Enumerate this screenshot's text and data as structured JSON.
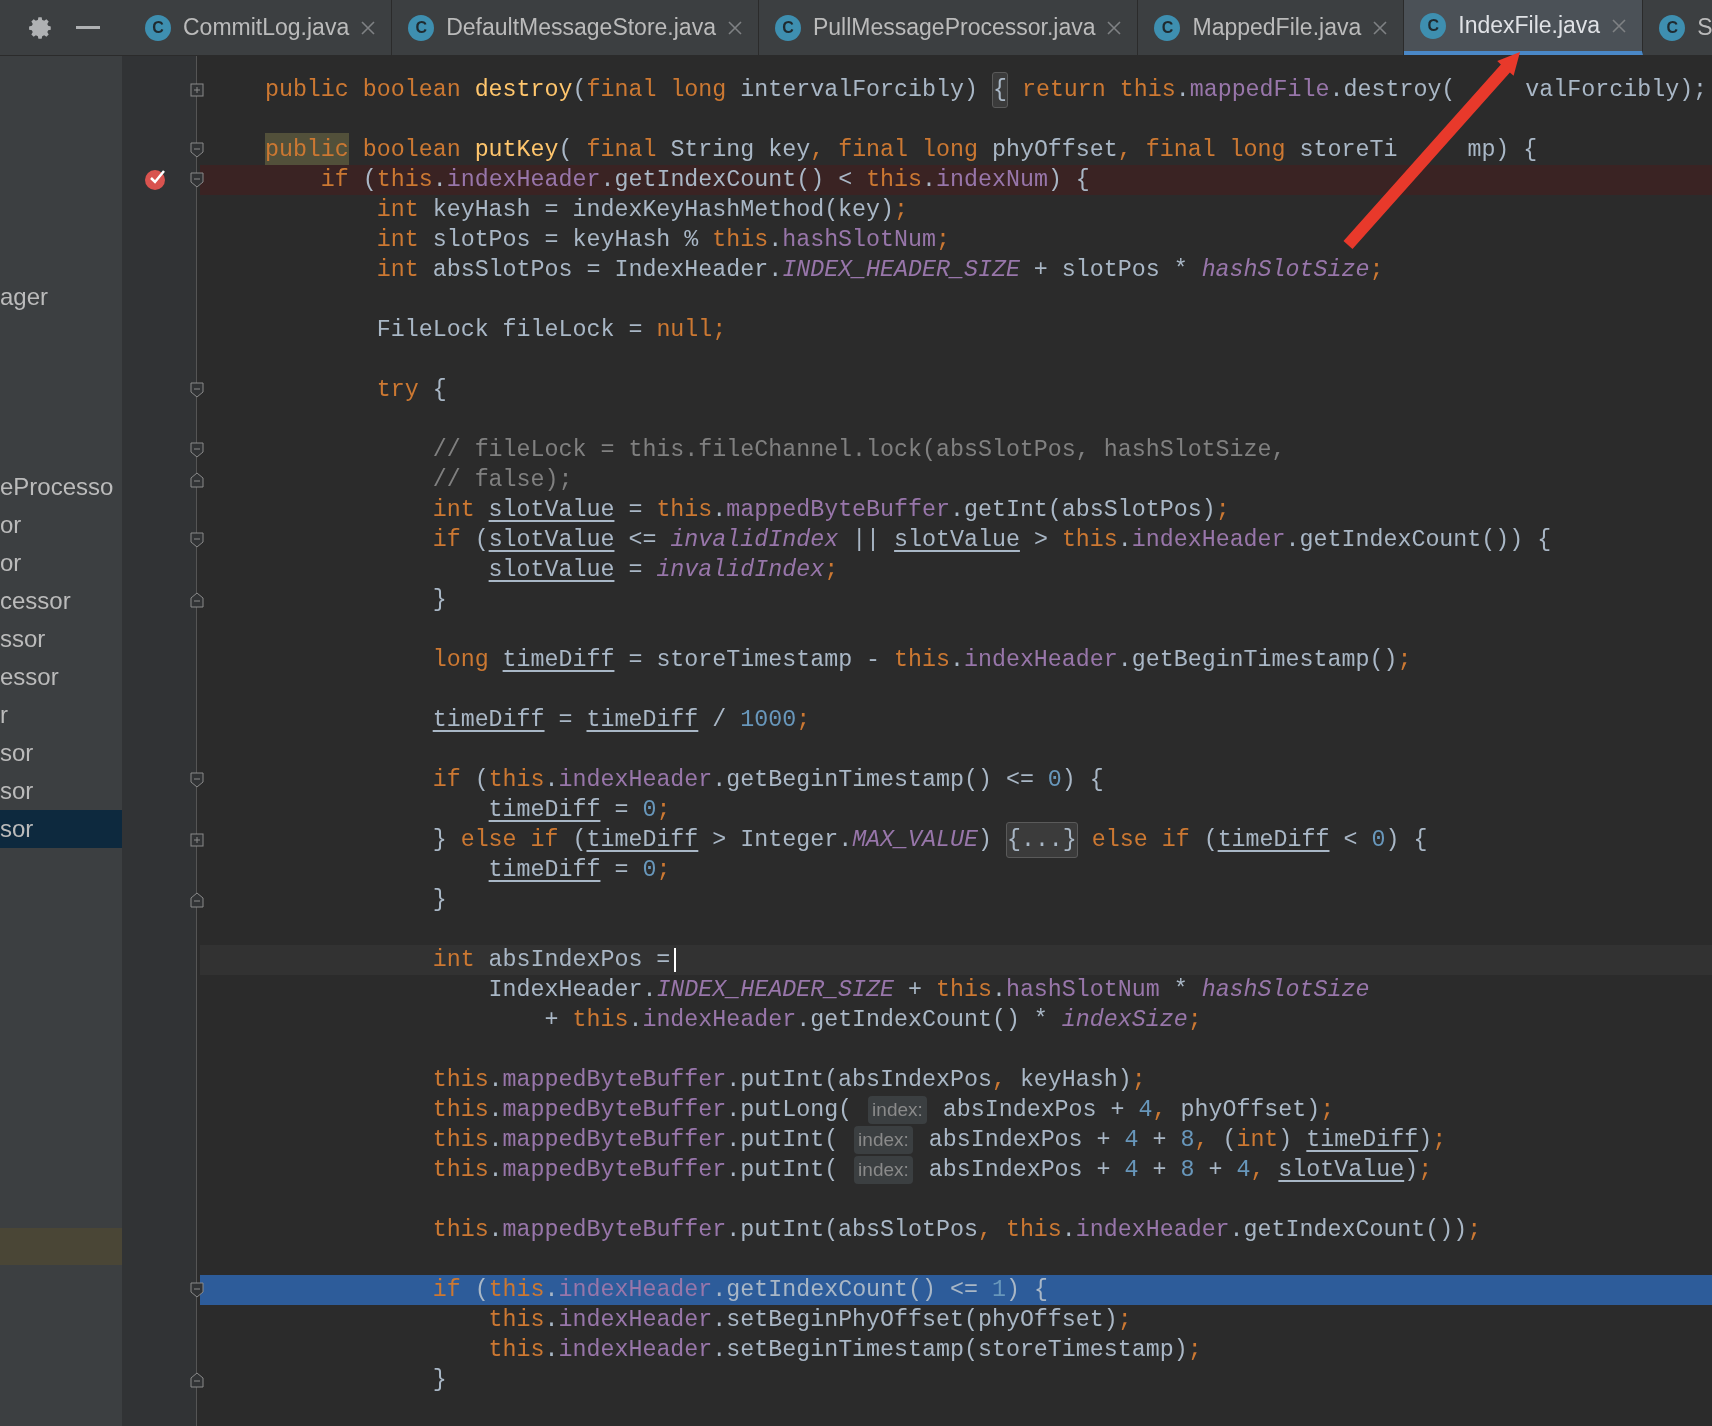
{
  "tabs": [
    {
      "icon_letter": "C",
      "label": "CommitLog.java",
      "selected": false
    },
    {
      "icon_letter": "C",
      "label": "DefaultMessageStore.java",
      "selected": false
    },
    {
      "icon_letter": "C",
      "label": "PullMessageProcessor.java",
      "selected": false
    },
    {
      "icon_letter": "C",
      "label": "MappedFile.java",
      "selected": false
    },
    {
      "icon_letter": "C",
      "label": "IndexFile.java",
      "selected": true
    },
    {
      "icon_letter": "C",
      "label": "S",
      "selected": false
    }
  ],
  "sidebar": {
    "items": [
      {
        "label": "ager",
        "selected": false
      },
      {
        "label": "eProcesso",
        "selected": false
      },
      {
        "label": "or",
        "selected": false
      },
      {
        "label": "or",
        "selected": false
      },
      {
        "label": "cessor",
        "selected": false
      },
      {
        "label": "ssor",
        "selected": false
      },
      {
        "label": "essor",
        "selected": false
      },
      {
        "label": "r",
        "selected": false
      },
      {
        "label": "sor",
        "selected": false
      },
      {
        "label": "sor",
        "selected": false
      },
      {
        "label": "sor",
        "selected": true
      }
    ]
  },
  "editor": {
    "lines": [
      {
        "kind": "code",
        "collapsed": true,
        "tokens": [
          {
            "kind": "k",
            "text": "    public boolean "
          },
          {
            "kind": "m",
            "text": "destroy"
          },
          {
            "kind": "p",
            "text": "("
          },
          {
            "kind": "k",
            "text": "final long "
          },
          {
            "kind": "p",
            "text": "intervalForcibly) "
          },
          {
            "kind": "fold",
            "text": "{"
          },
          {
            "kind": "k",
            "text": " return this"
          },
          {
            "kind": "p",
            "text": "."
          },
          {
            "kind": "f",
            "text": "mappedFile"
          },
          {
            "kind": "p",
            "text": ".destroy("
          },
          {
            "kind": "gap"
          },
          {
            "kind": "p",
            "text": "valForcibly);"
          }
        ]
      },
      {
        "kind": "blank"
      },
      {
        "kind": "code",
        "fold_start": true,
        "tokens": [
          {
            "kind": "hl",
            "text": "    public"
          },
          {
            "kind": "k",
            "text": " boolean "
          },
          {
            "kind": "m",
            "text": "putKey"
          },
          {
            "kind": "p",
            "text": "( "
          },
          {
            "kind": "k",
            "text": "final "
          },
          {
            "kind": "p",
            "text": "String key"
          },
          {
            "kind": "k",
            "text": ", final long "
          },
          {
            "kind": "p",
            "text": "phyOffset"
          },
          {
            "kind": "k",
            "text": ", final long "
          },
          {
            "kind": "p",
            "text": "storeTi"
          },
          {
            "kind": "gap"
          },
          {
            "kind": "p",
            "text": "mp) {"
          }
        ]
      },
      {
        "kind": "code",
        "fold_start": true,
        "breakpoint": true,
        "tokens": [
          {
            "kind": "k",
            "text": "        if "
          },
          {
            "kind": "p",
            "text": "("
          },
          {
            "kind": "k",
            "text": "this"
          },
          {
            "kind": "p",
            "text": "."
          },
          {
            "kind": "f",
            "text": "indexHeader"
          },
          {
            "kind": "p",
            "text": ".getIndexCount() < "
          },
          {
            "kind": "k",
            "text": "this"
          },
          {
            "kind": "p",
            "text": "."
          },
          {
            "kind": "f",
            "text": "indexNum"
          },
          {
            "kind": "p",
            "text": ") {"
          }
        ]
      },
      {
        "kind": "code",
        "tokens": [
          {
            "kind": "k",
            "text": "            int "
          },
          {
            "kind": "p",
            "text": "keyHash = indexKeyHashMethod(key)"
          },
          {
            "kind": "k",
            "text": ";"
          }
        ]
      },
      {
        "kind": "code",
        "tokens": [
          {
            "kind": "k",
            "text": "            int "
          },
          {
            "kind": "p",
            "text": "slotPos = keyHash % "
          },
          {
            "kind": "k",
            "text": "this"
          },
          {
            "kind": "p",
            "text": "."
          },
          {
            "kind": "f",
            "text": "hashSlotNum"
          },
          {
            "kind": "k",
            "text": ";"
          }
        ]
      },
      {
        "kind": "code",
        "tokens": [
          {
            "kind": "k",
            "text": "            int "
          },
          {
            "kind": "p",
            "text": "absSlotPos = IndexHeader."
          },
          {
            "kind": "s",
            "text": "INDEX_HEADER_SIZE"
          },
          {
            "kind": "p",
            "text": " + slotPos * "
          },
          {
            "kind": "s",
            "text": "hashSlotSize"
          },
          {
            "kind": "k",
            "text": ";"
          }
        ]
      },
      {
        "kind": "blank"
      },
      {
        "kind": "code",
        "tokens": [
          {
            "kind": "p",
            "text": "            FileLock fileLock = "
          },
          {
            "kind": "k",
            "text": "null;"
          }
        ]
      },
      {
        "kind": "blank"
      },
      {
        "kind": "code",
        "fold_start": true,
        "tokens": [
          {
            "kind": "k",
            "text": "            try "
          },
          {
            "kind": "p",
            "text": "{"
          }
        ]
      },
      {
        "kind": "blank"
      },
      {
        "kind": "code",
        "fold_start": true,
        "tokens": [
          {
            "kind": "c",
            "text": "                // fileLock = this.fileChannel.lock(absSlotPos, hashSlotSize,"
          }
        ]
      },
      {
        "kind": "code",
        "fold_end": true,
        "tokens": [
          {
            "kind": "c",
            "text": "                // false);"
          }
        ]
      },
      {
        "kind": "code",
        "tokens": [
          {
            "kind": "k",
            "text": "                int "
          },
          {
            "kind": "u",
            "text": "slotValue"
          },
          {
            "kind": "p",
            "text": " = "
          },
          {
            "kind": "k",
            "text": "this"
          },
          {
            "kind": "p",
            "text": "."
          },
          {
            "kind": "f",
            "text": "mappedByteBuffer"
          },
          {
            "kind": "p",
            "text": ".getInt(absSlotPos)"
          },
          {
            "kind": "k",
            "text": ";"
          }
        ]
      },
      {
        "kind": "code",
        "fold_start": true,
        "tokens": [
          {
            "kind": "k",
            "text": "                if "
          },
          {
            "kind": "p",
            "text": "("
          },
          {
            "kind": "u",
            "text": "slotValue"
          },
          {
            "kind": "p",
            "text": " <= "
          },
          {
            "kind": "s",
            "text": "invalidIndex"
          },
          {
            "kind": "p",
            "text": " || "
          },
          {
            "kind": "u",
            "text": "slotValue"
          },
          {
            "kind": "p",
            "text": " > "
          },
          {
            "kind": "k",
            "text": "this"
          },
          {
            "kind": "p",
            "text": "."
          },
          {
            "kind": "f",
            "text": "indexHeader"
          },
          {
            "kind": "p",
            "text": ".getIndexCount()) {"
          }
        ]
      },
      {
        "kind": "code",
        "tokens": [
          {
            "kind": "u",
            "text": "                    slotValue"
          },
          {
            "kind": "p",
            "text": " = "
          },
          {
            "kind": "s",
            "text": "invalidIndex"
          },
          {
            "kind": "k",
            "text": ";"
          }
        ]
      },
      {
        "kind": "code",
        "fold_end": true,
        "tokens": [
          {
            "kind": "p",
            "text": "                }"
          }
        ]
      },
      {
        "kind": "blank"
      },
      {
        "kind": "code",
        "tokens": [
          {
            "kind": "k",
            "text": "                long "
          },
          {
            "kind": "u",
            "text": "timeDiff"
          },
          {
            "kind": "p",
            "text": " = storeTimestamp - "
          },
          {
            "kind": "k",
            "text": "this"
          },
          {
            "kind": "p",
            "text": "."
          },
          {
            "kind": "f",
            "text": "indexHeader"
          },
          {
            "kind": "p",
            "text": ".getBeginTimestamp()"
          },
          {
            "kind": "k",
            "text": ";"
          }
        ]
      },
      {
        "kind": "blank"
      },
      {
        "kind": "code",
        "tokens": [
          {
            "kind": "u",
            "text": "                timeDiff"
          },
          {
            "kind": "p",
            "text": " = "
          },
          {
            "kind": "u",
            "text": "timeDiff"
          },
          {
            "kind": "p",
            "text": " / "
          },
          {
            "kind": "n",
            "text": "1000"
          },
          {
            "kind": "k",
            "text": ";"
          }
        ]
      },
      {
        "kind": "blank"
      },
      {
        "kind": "code",
        "fold_start": true,
        "tokens": [
          {
            "kind": "k",
            "text": "                if "
          },
          {
            "kind": "p",
            "text": "("
          },
          {
            "kind": "k",
            "text": "this"
          },
          {
            "kind": "p",
            "text": "."
          },
          {
            "kind": "f",
            "text": "indexHeader"
          },
          {
            "kind": "p",
            "text": ".getBeginTimestamp() <= "
          },
          {
            "kind": "n",
            "text": "0"
          },
          {
            "kind": "p",
            "text": ") {"
          }
        ]
      },
      {
        "kind": "code",
        "tokens": [
          {
            "kind": "u",
            "text": "                    timeDiff"
          },
          {
            "kind": "p",
            "text": " = "
          },
          {
            "kind": "n",
            "text": "0"
          },
          {
            "kind": "k",
            "text": ";"
          }
        ]
      },
      {
        "kind": "code",
        "collapsed": true,
        "tokens": [
          {
            "kind": "p",
            "text": "                } "
          },
          {
            "kind": "k",
            "text": "else if "
          },
          {
            "kind": "p",
            "text": "("
          },
          {
            "kind": "u",
            "text": "timeDiff"
          },
          {
            "kind": "p",
            "text": " > Integer."
          },
          {
            "kind": "s",
            "text": "MAX_VALUE"
          },
          {
            "kind": "p",
            "text": ") "
          },
          {
            "kind": "fold",
            "text": "{...}"
          },
          {
            "kind": "k",
            "text": " else if "
          },
          {
            "kind": "p",
            "text": "("
          },
          {
            "kind": "u",
            "text": "timeDiff"
          },
          {
            "kind": "p",
            "text": " < "
          },
          {
            "kind": "n",
            "text": "0"
          },
          {
            "kind": "p",
            "text": ") {"
          }
        ]
      },
      {
        "kind": "code",
        "tokens": [
          {
            "kind": "u",
            "text": "                    timeDiff"
          },
          {
            "kind": "p",
            "text": " = "
          },
          {
            "kind": "n",
            "text": "0"
          },
          {
            "kind": "k",
            "text": ";"
          }
        ]
      },
      {
        "kind": "code",
        "fold_end": true,
        "tokens": [
          {
            "kind": "p",
            "text": "                }"
          }
        ]
      },
      {
        "kind": "blank"
      },
      {
        "kind": "code",
        "caret": true,
        "tokens": [
          {
            "kind": "k",
            "text": "                int "
          },
          {
            "kind": "p",
            "text": "absIndexPos ="
          }
        ]
      },
      {
        "kind": "code",
        "tokens": [
          {
            "kind": "p",
            "text": "                    IndexHeader."
          },
          {
            "kind": "s",
            "text": "INDEX_HEADER_SIZE"
          },
          {
            "kind": "p",
            "text": " + "
          },
          {
            "kind": "k",
            "text": "this"
          },
          {
            "kind": "p",
            "text": "."
          },
          {
            "kind": "f",
            "text": "hashSlotNum"
          },
          {
            "kind": "p",
            "text": " * "
          },
          {
            "kind": "s",
            "text": "hashSlotSize"
          }
        ]
      },
      {
        "kind": "code",
        "tokens": [
          {
            "kind": "p",
            "text": "                        + "
          },
          {
            "kind": "k",
            "text": "this"
          },
          {
            "kind": "p",
            "text": "."
          },
          {
            "kind": "f",
            "text": "indexHeader"
          },
          {
            "kind": "p",
            "text": ".getIndexCount() * "
          },
          {
            "kind": "s",
            "text": "indexSize"
          },
          {
            "kind": "k",
            "text": ";"
          }
        ]
      },
      {
        "kind": "blank"
      },
      {
        "kind": "code",
        "tokens": [
          {
            "kind": "k",
            "text": "                this"
          },
          {
            "kind": "p",
            "text": "."
          },
          {
            "kind": "f",
            "text": "mappedByteBuffer"
          },
          {
            "kind": "p",
            "text": ".putInt(absIndexPos"
          },
          {
            "kind": "k",
            "text": ", "
          },
          {
            "kind": "p",
            "text": "keyHash)"
          },
          {
            "kind": "k",
            "text": ";"
          }
        ]
      },
      {
        "kind": "code",
        "tokens": [
          {
            "kind": "k",
            "text": "                this"
          },
          {
            "kind": "p",
            "text": "."
          },
          {
            "kind": "f",
            "text": "mappedByteBuffer"
          },
          {
            "kind": "p",
            "text": ".putLong( "
          },
          {
            "kind": "h",
            "text": "index:"
          },
          {
            "kind": "p",
            "text": " absIndexPos + "
          },
          {
            "kind": "n",
            "text": "4"
          },
          {
            "kind": "k",
            "text": ", "
          },
          {
            "kind": "p",
            "text": "phyOffset)"
          },
          {
            "kind": "k",
            "text": ";"
          }
        ]
      },
      {
        "kind": "code",
        "tokens": [
          {
            "kind": "k",
            "text": "                this"
          },
          {
            "kind": "p",
            "text": "."
          },
          {
            "kind": "f",
            "text": "mappedByteBuffer"
          },
          {
            "kind": "p",
            "text": ".putInt( "
          },
          {
            "kind": "h",
            "text": "index:"
          },
          {
            "kind": "p",
            "text": " absIndexPos + "
          },
          {
            "kind": "n",
            "text": "4"
          },
          {
            "kind": "p",
            "text": " + "
          },
          {
            "kind": "n",
            "text": "8"
          },
          {
            "kind": "k",
            "text": ", "
          },
          {
            "kind": "p",
            "text": "("
          },
          {
            "kind": "k",
            "text": "int"
          },
          {
            "kind": "p",
            "text": ") "
          },
          {
            "kind": "u",
            "text": "timeDiff"
          },
          {
            "kind": "p",
            "text": ")"
          },
          {
            "kind": "k",
            "text": ";"
          }
        ]
      },
      {
        "kind": "code",
        "tokens": [
          {
            "kind": "k",
            "text": "                this"
          },
          {
            "kind": "p",
            "text": "."
          },
          {
            "kind": "f",
            "text": "mappedByteBuffer"
          },
          {
            "kind": "p",
            "text": ".putInt( "
          },
          {
            "kind": "h",
            "text": "index:"
          },
          {
            "kind": "p",
            "text": " absIndexPos + "
          },
          {
            "kind": "n",
            "text": "4"
          },
          {
            "kind": "p",
            "text": " + "
          },
          {
            "kind": "n",
            "text": "8"
          },
          {
            "kind": "p",
            "text": " + "
          },
          {
            "kind": "n",
            "text": "4"
          },
          {
            "kind": "k",
            "text": ", "
          },
          {
            "kind": "u",
            "text": "slotValue"
          },
          {
            "kind": "p",
            "text": ")"
          },
          {
            "kind": "k",
            "text": ";"
          }
        ]
      },
      {
        "kind": "blank"
      },
      {
        "kind": "code",
        "tokens": [
          {
            "kind": "k",
            "text": "                this"
          },
          {
            "kind": "p",
            "text": "."
          },
          {
            "kind": "f",
            "text": "mappedByteBuffer"
          },
          {
            "kind": "p",
            "text": ".putInt(absSlotPos"
          },
          {
            "kind": "k",
            "text": ", this"
          },
          {
            "kind": "p",
            "text": "."
          },
          {
            "kind": "f",
            "text": "indexHeader"
          },
          {
            "kind": "p",
            "text": ".getIndexCount())"
          },
          {
            "kind": "k",
            "text": ";"
          }
        ]
      },
      {
        "kind": "blank"
      },
      {
        "kind": "code",
        "fold_start": true,
        "selected": true,
        "tokens": [
          {
            "kind": "k",
            "text": "                if "
          },
          {
            "kind": "p",
            "text": "("
          },
          {
            "kind": "k",
            "text": "this"
          },
          {
            "kind": "p",
            "text": "."
          },
          {
            "kind": "f",
            "text": "indexHeader"
          },
          {
            "kind": "p",
            "text": ".getIndexCount() <= "
          },
          {
            "kind": "n",
            "text": "1"
          },
          {
            "kind": "p",
            "text": ") {"
          }
        ]
      },
      {
        "kind": "code",
        "tokens": [
          {
            "kind": "k",
            "text": "                    this"
          },
          {
            "kind": "p",
            "text": "."
          },
          {
            "kind": "f",
            "text": "indexHeader"
          },
          {
            "kind": "p",
            "text": ".setBeginPhyOffset(phyOffset)"
          },
          {
            "kind": "k",
            "text": ";"
          }
        ]
      },
      {
        "kind": "code",
        "tokens": [
          {
            "kind": "k",
            "text": "                    this"
          },
          {
            "kind": "p",
            "text": "."
          },
          {
            "kind": "f",
            "text": "indexHeader"
          },
          {
            "kind": "p",
            "text": ".setBeginTimestamp(storeTimestamp)"
          },
          {
            "kind": "k",
            "text": ";"
          }
        ]
      },
      {
        "kind": "code",
        "fold_end": true,
        "tokens": [
          {
            "kind": "p",
            "text": "                }"
          }
        ]
      }
    ]
  }
}
